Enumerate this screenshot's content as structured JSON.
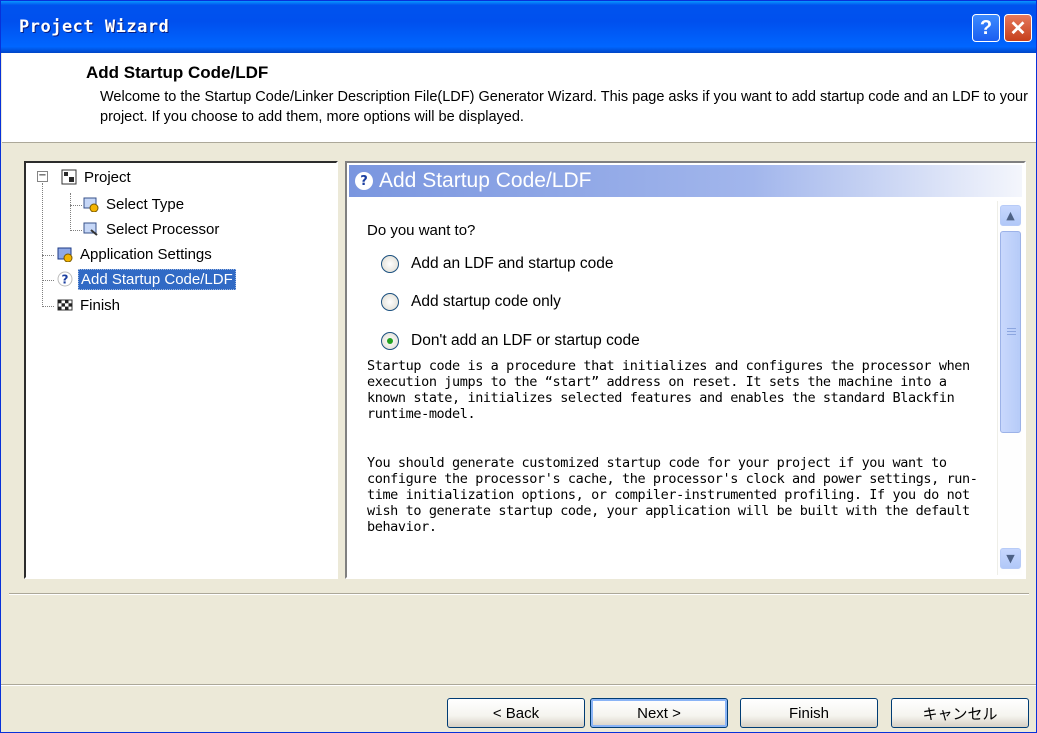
{
  "window": {
    "title": "Project Wizard"
  },
  "header": {
    "title": "Add Startup Code/LDF",
    "description": "Welcome to the Startup Code/Linker Description File(LDF) Generator Wizard.  This page asks if you want to add startup code and an LDF to your project.  If you choose to add them, more options will be displayed."
  },
  "tree": {
    "root": "Project",
    "children": [
      "Select Type",
      "Select Processor"
    ],
    "items": [
      "Application Settings",
      "Add Startup Code/LDF",
      "Finish"
    ]
  },
  "panel": {
    "title": "Add Startup Code/LDF",
    "question": "Do you want to?",
    "options": [
      {
        "label": "Add an LDF and startup code",
        "checked": false
      },
      {
        "label": "Add startup code only",
        "checked": false
      },
      {
        "label": "Don't add an LDF or startup code",
        "checked": true
      }
    ],
    "para1": "Startup code is a procedure that initializes and configures the processor when execution jumps to the “start” address on reset. It sets the machine into a known state, initializes selected features and enables the standard Blackfin runtime-model.",
    "para2": "You should generate customized startup code for your project if you want to configure the processor's cache, the processor's clock and power settings, run-time initialization options, or compiler-instrumented profiling. If you do not wish to generate startup code, your application will be built with the default behavior."
  },
  "buttons": {
    "back": "< Back",
    "next": "Next >",
    "finish": "Finish",
    "cancel": "キャンセル"
  },
  "icons": {
    "help": "?",
    "close": "✕",
    "scroll_up": "▲",
    "scroll_down": "▼"
  }
}
